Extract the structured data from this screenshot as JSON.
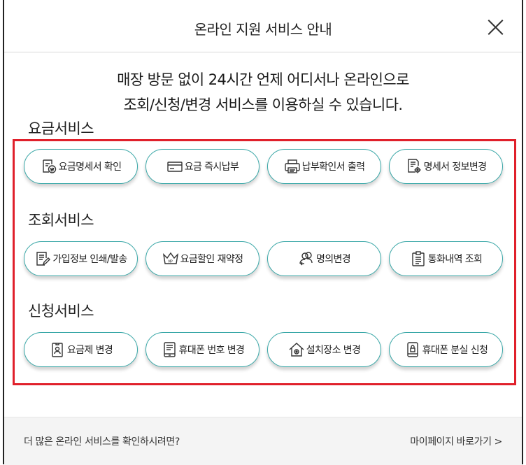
{
  "header": {
    "title": "온라인 지원 서비스 안내"
  },
  "intro": {
    "line1": "매장 방문 없이 24시간 언제 어디서나 온라인으로",
    "line2": "조회/신청/변경 서비스를 이용하실 수 있습니다."
  },
  "sections": [
    {
      "title": "요금서비스",
      "buttons": [
        {
          "label": "요금명세서 확인",
          "icon": "bill-check-icon"
        },
        {
          "label": "요금 즉시납부",
          "icon": "card-icon"
        },
        {
          "label": "납부확인서 출력",
          "icon": "printer-icon"
        },
        {
          "label": "명세서 정보변경",
          "icon": "doc-gear-icon"
        }
      ]
    },
    {
      "title": "조회서비스",
      "buttons": [
        {
          "label": "가입정보 인쇄/발송",
          "icon": "doc-edit-icon"
        },
        {
          "label": "요금할인 재약정",
          "icon": "vip-crown-icon"
        },
        {
          "label": "명의변경",
          "icon": "user-swap-icon"
        },
        {
          "label": "통화내역 조회",
          "icon": "clipboard-list-icon"
        }
      ]
    },
    {
      "title": "신청서비스",
      "buttons": [
        {
          "label": "요금제 변경",
          "icon": "id-badge-icon"
        },
        {
          "label": "휴대폰 번호 변경",
          "icon": "phone-number-icon"
        },
        {
          "label": "설치장소 변경",
          "icon": "house-icon"
        },
        {
          "label": "휴대폰 분실 신청",
          "icon": "phone-lock-icon"
        }
      ]
    }
  ],
  "footer": {
    "text": "더 많은 온라인 서비스를 확인하시려면?",
    "link": "마이페이지 바로가기 >"
  },
  "colors": {
    "accent": "#38a7a7",
    "highlight": "#e0202b",
    "footer_bg": "#f4f4f4"
  }
}
